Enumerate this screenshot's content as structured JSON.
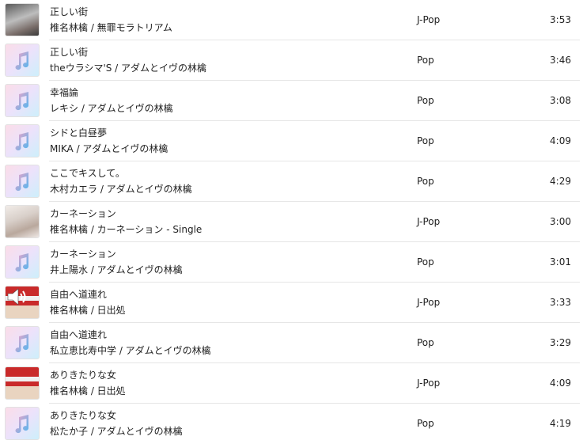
{
  "tracks": [
    {
      "title": "正しい街",
      "subtitle": "椎名林檎 / 無罪モラトリアム",
      "genre": "J-Pop",
      "time": "3:53",
      "art": "photo-artwork"
    },
    {
      "title": "正しい街",
      "subtitle": "theウラシマ'S / アダムとイヴの林檎",
      "genre": "Pop",
      "time": "3:46",
      "art": "music-note-icon"
    },
    {
      "title": "幸福論",
      "subtitle": "レキシ / アダムとイヴの林檎",
      "genre": "Pop",
      "time": "3:08",
      "art": "music-note-icon"
    },
    {
      "title": "シドと白昼夢",
      "subtitle": "MIKA / アダムとイヴの林檎",
      "genre": "Pop",
      "time": "4:09",
      "art": "music-note-icon"
    },
    {
      "title": "ここでキスして。",
      "subtitle": "木村カエラ / アダムとイヴの林檎",
      "genre": "Pop",
      "time": "4:29",
      "art": "music-note-icon"
    },
    {
      "title": "カーネーション",
      "subtitle": "椎名林檎 / カーネーション - Single",
      "genre": "J-Pop",
      "time": "3:00",
      "art": "photo-artwork"
    },
    {
      "title": "カーネーション",
      "subtitle": "井上陽水 / アダムとイヴの林檎",
      "genre": "Pop",
      "time": "3:01",
      "art": "music-note-icon"
    },
    {
      "title": "自由へ道連れ",
      "subtitle": "椎名林檎 / 日出処",
      "genre": "J-Pop",
      "time": "3:33",
      "art": "photo-artwork-now-playing"
    },
    {
      "title": "自由へ道連れ",
      "subtitle": "私立恵比寿中学 / アダムとイヴの林檎",
      "genre": "Pop",
      "time": "3:29",
      "art": "music-note-icon"
    },
    {
      "title": "ありきたりな女",
      "subtitle": "椎名林檎 / 日出処",
      "genre": "J-Pop",
      "time": "4:09",
      "art": "photo-artwork"
    },
    {
      "title": "ありきたりな女",
      "subtitle": "松たか子 / アダムとイヴの林檎",
      "genre": "Pop",
      "time": "4:19",
      "art": "music-note-icon"
    }
  ],
  "colors": {
    "separator": "#e6e6e6",
    "text": "#222222",
    "note_gradient_start": "#f5a3c7",
    "note_gradient_end": "#4fb6f0"
  }
}
